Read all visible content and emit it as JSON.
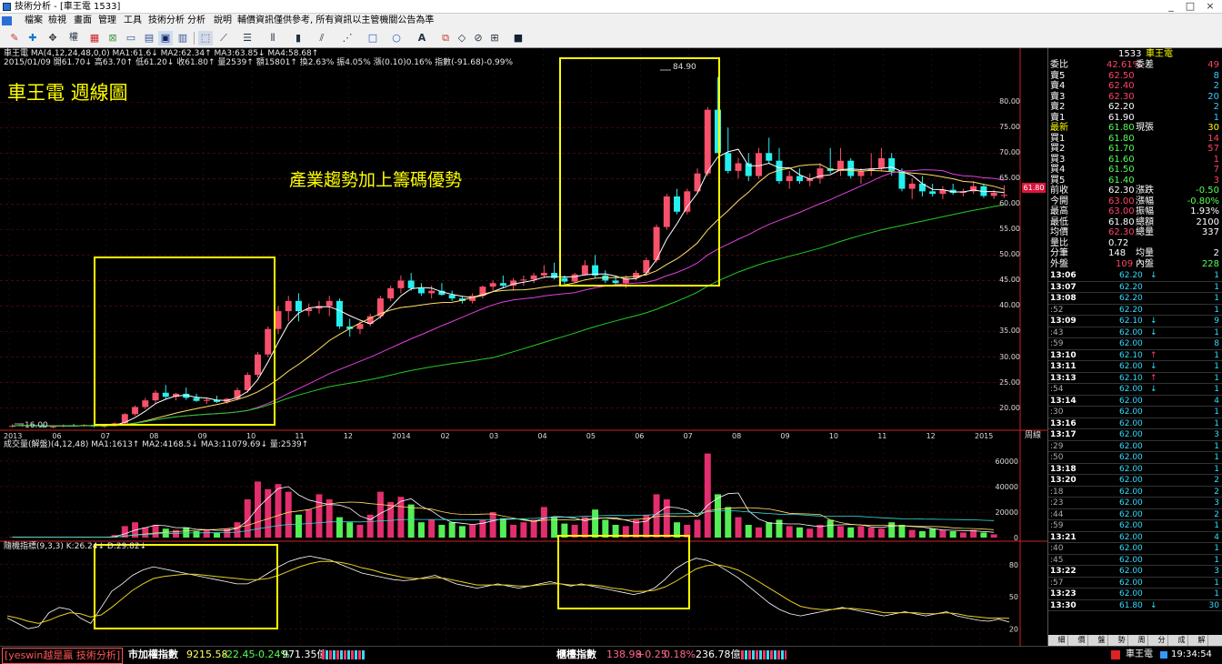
{
  "window": {
    "title": "技術分析 - [車王電 1533]",
    "buttons": [
      "_",
      "□",
      "×"
    ]
  },
  "menu": [
    "檔案",
    "檢視",
    "畫面",
    "管理",
    "工具",
    "技術分析",
    "分析",
    "說明",
    "輔價資訊僅供參考, 所有資訊以主管機關公告為準"
  ],
  "toolbar": {
    "zoom_label": "權"
  },
  "header": {
    "line1": "車王電 MA(4,12,24,48,0,0) MA1:61.6↓ MA2:62.34↑ MA3:63.85↓ MA4:58.68↑",
    "line2": "2015/01/09 開61.70↓ 高63.70↑ 低61.20↓ 收61.80↑ 量2539↑ 額15801↑ 換2.63% 振4.05% 漲(0.10)0.16% 指數(-91.68)-0.99%",
    "volume_line": "成交量(解盤)(4,12,48) MA1:1613↑ MA2:4168.5↓ MA3:11079.69↓ 量:2539↑",
    "kd_line": "隨機指標(9,3,3) K:26.24↓ D:29.82↓"
  },
  "chart_title": "車王電 週線圖",
  "annotation": "產業趨勢加上籌碼優勢",
  "weekly_label": "周線",
  "current_price_tag": "61.80",
  "colors": {
    "up": "#f8516b",
    "down": "#25f0f0",
    "ma1": "#ffffff",
    "ma2": "#ffe066",
    "ma3": "#e040e0",
    "ma4": "#22cc22",
    "vol_up": "#e22e6e",
    "vol_down": "#55ee55",
    "box": "#ffff00"
  },
  "chart_data": {
    "type": "candlestick",
    "y_ticks": [
      "80.00",
      "75.00",
      "70.00",
      "65.00",
      "60.00",
      "55.00",
      "50.00",
      "45.00",
      "40.00",
      "35.00",
      "30.00",
      "25.00",
      "20.00"
    ],
    "ylim": [
      16,
      87
    ],
    "x_labels": [
      "2013",
      "06",
      "07",
      "08",
      "09",
      "10",
      "11",
      "12",
      "2014",
      "02",
      "03",
      "04",
      "05",
      "06",
      "07",
      "08",
      "09",
      "10",
      "11",
      "12",
      "2015"
    ],
    "peak_label": "84.90",
    "low_label": "16.00",
    "volume_ticks": [
      "60000",
      "40000",
      "20000",
      "0"
    ],
    "kd_ticks": [
      "80",
      "50",
      "20"
    ],
    "candles": [
      [
        16.5,
        16.8,
        16.2,
        16.5
      ],
      [
        16.6,
        17,
        16.3,
        16.7
      ],
      [
        16.7,
        16.9,
        16.4,
        16.6
      ],
      [
        16.6,
        16.8,
        16.1,
        16.3
      ],
      [
        16.3,
        16.6,
        16.0,
        16.4
      ],
      [
        16.4,
        16.8,
        16.2,
        16.6
      ],
      [
        16.6,
        16.9,
        16.4,
        16.5
      ],
      [
        16.5,
        16.8,
        16.3,
        16.7
      ],
      [
        16.7,
        16.9,
        16.2,
        16.4
      ],
      [
        16.4,
        16.7,
        16.1,
        16.5
      ],
      [
        16.5,
        17.2,
        16.4,
        17
      ],
      [
        17,
        19,
        16.8,
        18.8
      ],
      [
        18.8,
        20.5,
        18.5,
        20.2
      ],
      [
        20.2,
        22,
        19.8,
        21.5
      ],
      [
        21.5,
        23.5,
        21,
        23
      ],
      [
        23,
        24.5,
        21.8,
        22.2
      ],
      [
        22.2,
        23,
        21.5,
        22.8
      ],
      [
        22.8,
        24,
        21.6,
        22
      ],
      [
        22,
        22.8,
        21.2,
        21.4
      ],
      [
        21.4,
        22,
        20.8,
        21.6
      ],
      [
        21.6,
        22.4,
        21,
        21.2
      ],
      [
        21.2,
        22,
        20.8,
        21.8
      ],
      [
        21.8,
        24,
        21.5,
        23.5
      ],
      [
        23.5,
        27,
        23,
        26.5
      ],
      [
        26.5,
        31,
        26,
        30.5
      ],
      [
        30.5,
        36,
        30,
        35.5
      ],
      [
        35.5,
        40,
        34.5,
        39
      ],
      [
        39,
        42,
        37,
        41
      ],
      [
        41,
        42.5,
        37,
        39
      ],
      [
        39,
        40.5,
        38,
        39.5
      ],
      [
        39.5,
        41,
        38.5,
        40
      ],
      [
        40,
        42,
        38,
        41
      ],
      [
        41,
        41.5,
        35.5,
        36
      ],
      [
        36,
        37.5,
        34,
        35.5
      ],
      [
        35.5,
        37,
        34.5,
        36.5
      ],
      [
        36.5,
        38.5,
        36,
        38
      ],
      [
        38,
        42,
        37.5,
        41.5
      ],
      [
        41.5,
        44,
        41,
        43.5
      ],
      [
        43.5,
        46,
        42.5,
        45
      ],
      [
        45,
        46.5,
        43,
        43.5
      ],
      [
        43.5,
        44.5,
        42,
        42.5
      ],
      [
        42.5,
        44,
        41.5,
        43
      ],
      [
        43,
        44.5,
        42,
        42.2
      ],
      [
        42.2,
        43,
        41,
        41.5
      ],
      [
        41.5,
        42,
        40.5,
        41
      ],
      [
        41,
        42.5,
        40.5,
        42
      ],
      [
        42,
        44,
        41.5,
        43.8
      ],
      [
        43.8,
        45,
        43,
        44.5
      ],
      [
        44.5,
        46,
        43.5,
        44
      ],
      [
        44,
        45.5,
        43,
        45
      ],
      [
        45,
        46,
        44,
        45.2
      ],
      [
        45.2,
        46.5,
        44.5,
        46
      ],
      [
        46,
        48,
        45.5,
        46.5
      ],
      [
        46.5,
        48.5,
        45.2,
        45.5
      ],
      [
        45.5,
        46,
        44,
        44.8
      ],
      [
        44.8,
        46.5,
        44.5,
        46.2
      ],
      [
        46.2,
        49,
        46,
        48
      ],
      [
        48,
        50,
        45.5,
        46
      ],
      [
        46,
        47,
        44.5,
        45
      ],
      [
        45,
        46,
        44,
        44.5
      ],
      [
        44.5,
        46,
        43.5,
        45.5
      ],
      [
        45.5,
        47,
        45,
        46.5
      ],
      [
        46.5,
        49.5,
        46,
        49
      ],
      [
        49,
        56,
        48.5,
        55.5
      ],
      [
        55.5,
        62,
        55,
        61.5
      ],
      [
        61.5,
        63,
        58,
        58.5
      ],
      [
        58.5,
        63,
        58,
        62.5
      ],
      [
        62.5,
        67,
        62,
        66
      ],
      [
        66,
        79,
        65.5,
        78.5
      ],
      [
        78.5,
        84.9,
        73,
        70
      ],
      [
        70,
        75,
        66,
        66.5
      ],
      [
        66.5,
        69,
        65,
        68
      ],
      [
        68,
        70,
        64.5,
        65.5
      ],
      [
        65.5,
        71,
        65,
        70
      ],
      [
        70,
        73,
        68,
        68.5
      ],
      [
        68.5,
        71,
        64,
        64.5
      ],
      [
        64.5,
        66.5,
        63,
        65.5
      ],
      [
        65.5,
        67,
        64,
        64.5
      ],
      [
        64.5,
        66,
        63.5,
        65
      ],
      [
        65,
        68,
        64,
        67
      ],
      [
        67,
        71,
        66,
        66.5
      ],
      [
        66.5,
        71,
        65.5,
        68.5
      ],
      [
        68.5,
        69,
        65,
        65.5
      ],
      [
        65.5,
        67,
        64,
        66.5
      ],
      [
        66.5,
        70,
        65.5,
        67
      ],
      [
        67,
        71,
        66.5,
        69
      ],
      [
        69,
        70,
        65.5,
        66.5
      ],
      [
        66.5,
        67,
        62.5,
        63
      ],
      [
        63,
        65,
        61,
        64
      ],
      [
        64,
        65.5,
        61.5,
        62.5
      ],
      [
        62.5,
        64,
        61.5,
        62
      ],
      [
        62,
        63.5,
        61,
        62.8
      ],
      [
        62.8,
        64,
        61.8,
        62.2
      ],
      [
        62.2,
        63,
        61.5,
        62.5
      ],
      [
        62.5,
        64.5,
        62,
        63.5
      ],
      [
        63.5,
        64,
        61.2,
        61.6
      ],
      [
        61.6,
        62.8,
        61,
        62.2
      ],
      [
        61.7,
        63.7,
        61.2,
        61.8
      ]
    ],
    "volumes": [
      400,
      300,
      250,
      200,
      350,
      400,
      300,
      250,
      300,
      350,
      2000,
      9000,
      12000,
      8000,
      10000,
      7000,
      6000,
      8000,
      5000,
      6000,
      4000,
      7000,
      12000,
      30000,
      44000,
      38000,
      42000,
      36000,
      18000,
      22000,
      34000,
      30000,
      16000,
      12000,
      10000,
      18000,
      36000,
      28000,
      32000,
      26000,
      12000,
      14000,
      10000,
      12000,
      9000,
      10000,
      14000,
      20000,
      15000,
      10000,
      12000,
      14000,
      24000,
      16000,
      11000,
      10000,
      16000,
      22000,
      14000,
      10000,
      9000,
      14000,
      18000,
      34000,
      30000,
      12000,
      10000,
      14000,
      66000,
      34000,
      24000,
      16000,
      10000,
      8000,
      12000,
      14000,
      9000,
      8000,
      7000,
      10000,
      14000,
      9000,
      8000,
      9000,
      8000,
      7000,
      12000,
      10000,
      6000,
      5000,
      7000,
      6000,
      5000,
      4000,
      6000,
      4000,
      2539
    ],
    "kd_k": [
      30,
      25,
      20,
      22,
      35,
      40,
      38,
      30,
      25,
      40,
      55,
      62,
      70,
      75,
      78,
      76,
      74,
      72,
      70,
      68,
      66,
      64,
      62,
      62,
      66,
      72,
      78,
      83,
      86,
      88,
      86,
      84,
      80,
      76,
      72,
      70,
      68,
      66,
      65,
      66,
      68,
      70,
      66,
      62,
      60,
      58,
      60,
      62,
      60,
      58,
      60,
      62,
      64,
      62,
      60,
      62,
      60,
      58,
      56,
      54,
      52,
      54,
      58,
      66,
      76,
      82,
      86,
      84,
      80,
      74,
      68,
      60,
      52,
      44,
      38,
      34,
      32,
      34,
      36,
      38,
      40,
      38,
      36,
      34,
      32,
      34,
      36,
      34,
      32,
      34,
      36,
      32,
      30,
      28,
      27,
      29,
      26.24
    ],
    "kd_d": [
      32,
      30,
      27,
      25,
      28,
      32,
      35,
      34,
      31,
      33,
      40,
      48,
      56,
      62,
      67,
      69,
      70,
      71,
      71,
      70,
      69,
      68,
      67,
      66,
      66,
      67,
      70,
      74,
      78,
      81,
      83,
      83,
      82,
      80,
      77,
      75,
      72,
      70,
      68,
      67,
      67,
      68,
      67,
      65,
      63,
      61,
      61,
      61,
      61,
      60,
      60,
      61,
      62,
      62,
      61,
      61,
      61,
      60,
      58,
      57,
      55,
      55,
      56,
      59,
      64,
      70,
      76,
      79,
      80,
      78,
      75,
      70,
      64,
      58,
      52,
      46,
      41,
      39,
      38,
      38,
      39,
      39,
      38,
      37,
      35,
      35,
      35,
      35,
      34,
      34,
      35,
      34,
      32,
      31,
      30,
      30,
      29.82
    ]
  },
  "quote": {
    "code": "1533",
    "name": "車王電",
    "ratio": {
      "label": "委比",
      "value": "42.61%",
      "label2": "委差",
      "value2": "49"
    },
    "asks": [
      {
        "label": "賣5",
        "price": "62.50",
        "vol": "8"
      },
      {
        "label": "賣4",
        "price": "62.40",
        "vol": "2"
      },
      {
        "label": "賣3",
        "price": "62.30",
        "vol": "20"
      },
      {
        "label": "賣2",
        "price": "62.20",
        "vol": "2"
      },
      {
        "label": "賣1",
        "price": "61.90",
        "vol": "1"
      }
    ],
    "last": {
      "label": "最新",
      "price": "61.80",
      "label2": "現張",
      "vol": "30"
    },
    "bids": [
      {
        "label": "買1",
        "price": "61.80",
        "vol": "14"
      },
      {
        "label": "買2",
        "price": "61.70",
        "vol": "57"
      },
      {
        "label": "買3",
        "price": "61.60",
        "vol": "1"
      },
      {
        "label": "買4",
        "price": "61.50",
        "vol": "7"
      },
      {
        "label": "買5",
        "price": "61.40",
        "vol": "3"
      }
    ],
    "stats": [
      {
        "l1": "前收",
        "v1": "62.30",
        "l2": "漲跌",
        "v2": "-0.50"
      },
      {
        "l1": "今開",
        "v1": "63.00",
        "l2": "漲幅",
        "v2": "-0.80%"
      },
      {
        "l1": "最高",
        "v1": "63.00",
        "l2": "振幅",
        "v2": "1.93%"
      },
      {
        "l1": "最低",
        "v1": "61.80",
        "l2": "總額",
        "v2": "2100"
      },
      {
        "l1": "均價",
        "v1": "62.30",
        "l2": "總量",
        "v2": "337"
      },
      {
        "l1": "量比",
        "v1": "0.72",
        "l2": "",
        "v2": ""
      },
      {
        "l1": "分筆",
        "v1": "148",
        "l2": "均量",
        "v2": "2"
      }
    ],
    "outer": {
      "label": "外盤",
      "value": "109",
      "label2": "內盤",
      "value2": "228"
    },
    "ticks": [
      {
        "t": "13:06",
        "p": "62.20",
        "a": "↓",
        "v": "1"
      },
      {
        "t": "13:07",
        "p": "62.20",
        "a": "",
        "v": "1"
      },
      {
        "t": "13:08",
        "p": "62.20",
        "a": "",
        "v": "1"
      },
      {
        "t": ":52",
        "p": "62.20",
        "a": "",
        "v": "1"
      },
      {
        "t": "13:09",
        "p": "62.10",
        "a": "↓",
        "v": "9"
      },
      {
        "t": ":43",
        "p": "62.00",
        "a": "↓",
        "v": "1"
      },
      {
        "t": ":59",
        "p": "62.00",
        "a": "",
        "v": "8"
      },
      {
        "t": "13:10",
        "p": "62.10",
        "a": "↑",
        "v": "1"
      },
      {
        "t": "13:11",
        "p": "62.00",
        "a": "↓",
        "v": "1"
      },
      {
        "t": "13:13",
        "p": "62.10",
        "a": "↑",
        "v": "1"
      },
      {
        "t": ":54",
        "p": "62.00",
        "a": "↓",
        "v": "1"
      },
      {
        "t": "13:14",
        "p": "62.00",
        "a": "",
        "v": "4"
      },
      {
        "t": ":30",
        "p": "62.00",
        "a": "",
        "v": "1"
      },
      {
        "t": "13:16",
        "p": "62.00",
        "a": "",
        "v": "1"
      },
      {
        "t": "13:17",
        "p": "62.00",
        "a": "",
        "v": "3"
      },
      {
        "t": ":29",
        "p": "62.00",
        "a": "",
        "v": "1"
      },
      {
        "t": ":50",
        "p": "62.00",
        "a": "",
        "v": "1"
      },
      {
        "t": "13:18",
        "p": "62.00",
        "a": "",
        "v": "1"
      },
      {
        "t": "13:20",
        "p": "62.00",
        "a": "",
        "v": "2"
      },
      {
        "t": ":18",
        "p": "62.00",
        "a": "",
        "v": "2"
      },
      {
        "t": ":23",
        "p": "62.00",
        "a": "",
        "v": "3"
      },
      {
        "t": ":44",
        "p": "62.00",
        "a": "",
        "v": "2"
      },
      {
        "t": ":59",
        "p": "62.00",
        "a": "",
        "v": "1"
      },
      {
        "t": "13:21",
        "p": "62.00",
        "a": "",
        "v": "4"
      },
      {
        "t": ":40",
        "p": "62.00",
        "a": "",
        "v": "1"
      },
      {
        "t": ":45",
        "p": "62.00",
        "a": "",
        "v": "1"
      },
      {
        "t": "13:22",
        "p": "62.00",
        "a": "",
        "v": "3"
      },
      {
        "t": ":57",
        "p": "62.00",
        "a": "",
        "v": "1"
      },
      {
        "t": "13:23",
        "p": "62.00",
        "a": "",
        "v": "1"
      },
      {
        "t": "13:30",
        "p": "61.80",
        "a": "↓",
        "v": "30"
      }
    ],
    "tabs": [
      "細",
      "價",
      "盤",
      "勢",
      "周",
      "分",
      "成",
      "解"
    ]
  },
  "status": {
    "left": "[yeswin越是贏 技術分析]",
    "idx1_name": "市加權指數",
    "idx1_val": "9215.58",
    "idx1_chg": "-22.45",
    "idx1_pct": "-0.24%",
    "idx1_amt": "971.35億",
    "idx2_name": "櫃檯指數",
    "idx2_val": "138.98",
    "idx2_chg": "+0.25",
    "idx2_pct": "0.18%",
    "idx2_amt": "236.78億",
    "stock": "車王電",
    "time": "19:34:54"
  }
}
